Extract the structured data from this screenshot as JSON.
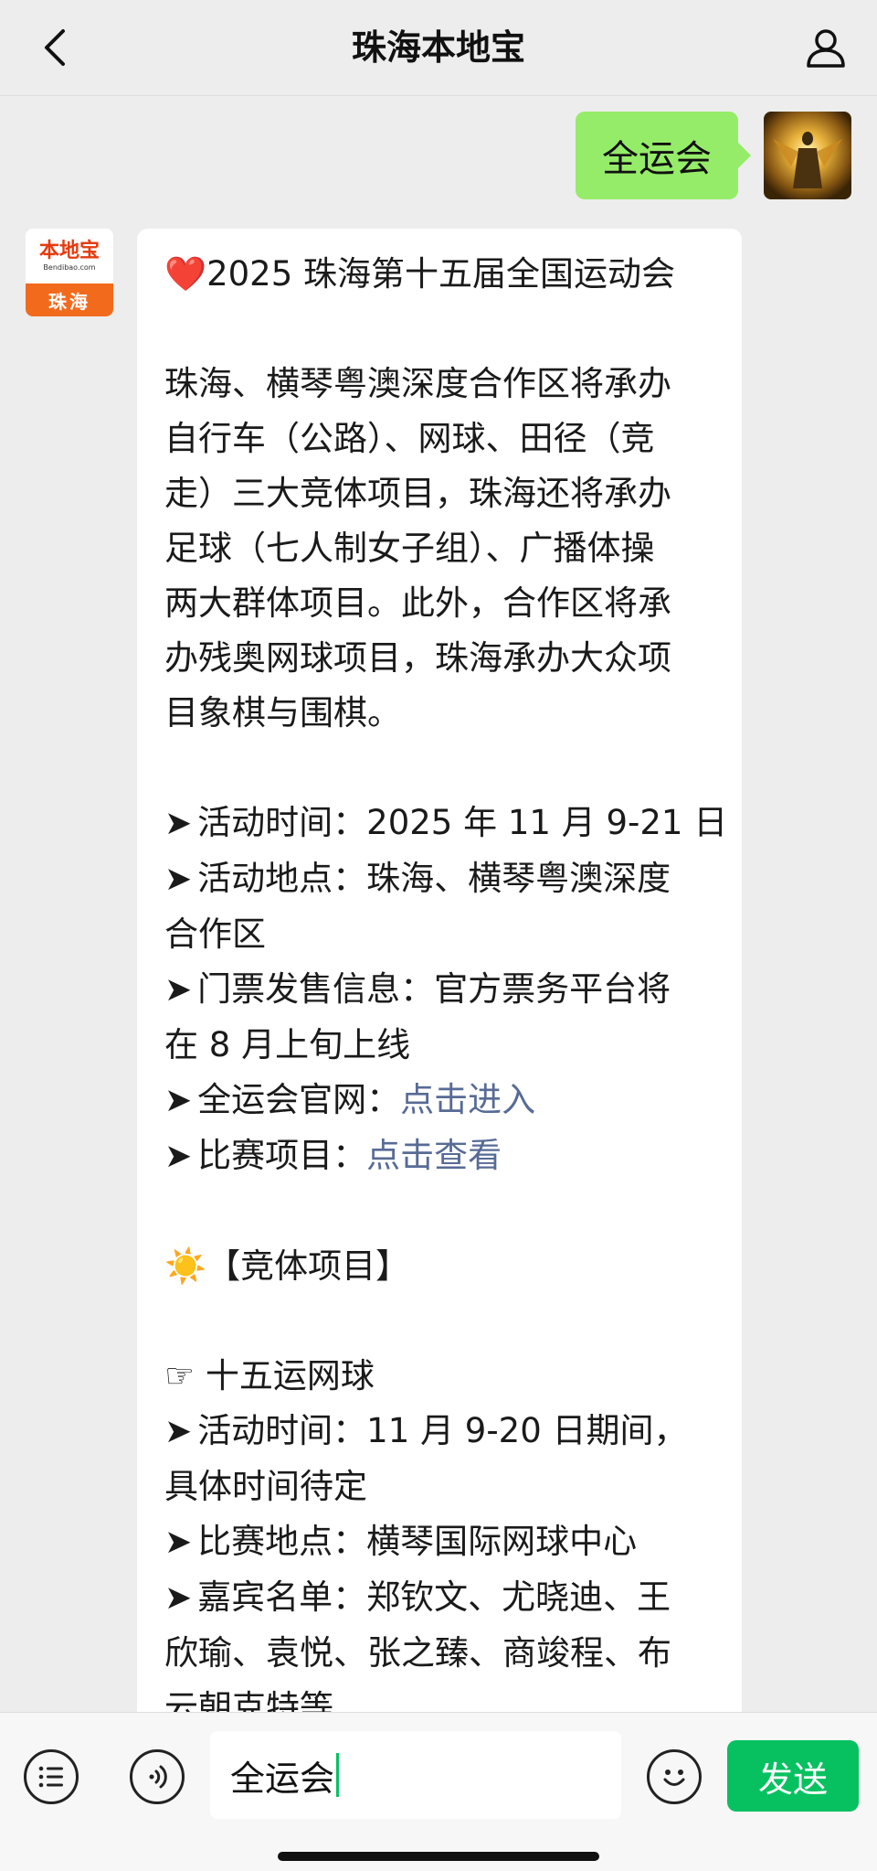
{
  "header": {
    "back_icon": "chevron-left-icon",
    "title": "珠海本地宝",
    "profile_icon": "person-icon"
  },
  "outgoing": {
    "text": "全运会",
    "bubble_color": "#95ec69"
  },
  "bot": {
    "avatar_logo_text": "本地宝",
    "avatar_logo_url": "Bendibao.com",
    "avatar_city": "珠海",
    "lines": [
      {
        "type": "text",
        "text": "❤️2025 珠海第十五届全国运动会"
      },
      {
        "type": "gap"
      },
      {
        "type": "text",
        "text": "珠海、横琴粤澳深度合作区将承办"
      },
      {
        "type": "text",
        "text": "自行车（公路）、网球、田径（竞"
      },
      {
        "type": "text",
        "text": "走）三大竞体项目，珠海还将承办"
      },
      {
        "type": "text",
        "text": "足球（七人制女子组）、广播体操"
      },
      {
        "type": "text",
        "text": "两大群体项目。此外，合作区将承"
      },
      {
        "type": "text",
        "text": "办残奥网球项目，珠海承办大众项"
      },
      {
        "type": "text",
        "text": "目象棋与围棋。"
      },
      {
        "type": "gap"
      },
      {
        "type": "arrow",
        "text": "活动时间：2025 年 11 月 9-21 日"
      },
      {
        "type": "arrow",
        "text": "活动地点：珠海、横琴粤澳深度"
      },
      {
        "type": "text",
        "text": "合作区"
      },
      {
        "type": "arrow",
        "text": "门票发售信息：官方票务平台将"
      },
      {
        "type": "text",
        "text": "在 8 月上旬上线"
      },
      {
        "type": "arrow_link",
        "text": "全运会官网：",
        "link": "点击进入"
      },
      {
        "type": "arrow_link",
        "text": "比赛项目：",
        "link": "点击查看"
      },
      {
        "type": "gap"
      },
      {
        "type": "text",
        "text": "☀️【竞体项目】"
      },
      {
        "type": "gap"
      },
      {
        "type": "text",
        "text": "☞ 十五运网球"
      },
      {
        "type": "arrow",
        "text": "活动时间：11 月 9-20 日期间，"
      },
      {
        "type": "text",
        "text": "具体时间待定"
      },
      {
        "type": "arrow",
        "text": "比赛地点：横琴国际网球中心"
      },
      {
        "type": "arrow",
        "text": "嘉宾名单：郑钦文、尤晓迪、王"
      },
      {
        "type": "text",
        "text": "欣瑜、袁悦、张之臻、商竣程、布"
      },
      {
        "type": "text",
        "text": "云朝克特等"
      }
    ],
    "arrow_glyph": "➤",
    "link_color": "#576b95"
  },
  "input_bar": {
    "menu_icon": "list-menu-icon",
    "voice_icon": "voice-icon",
    "input_value": "全运会",
    "emoji_icon": "emoji-icon",
    "send_label": "发送",
    "send_color": "#07c160"
  }
}
